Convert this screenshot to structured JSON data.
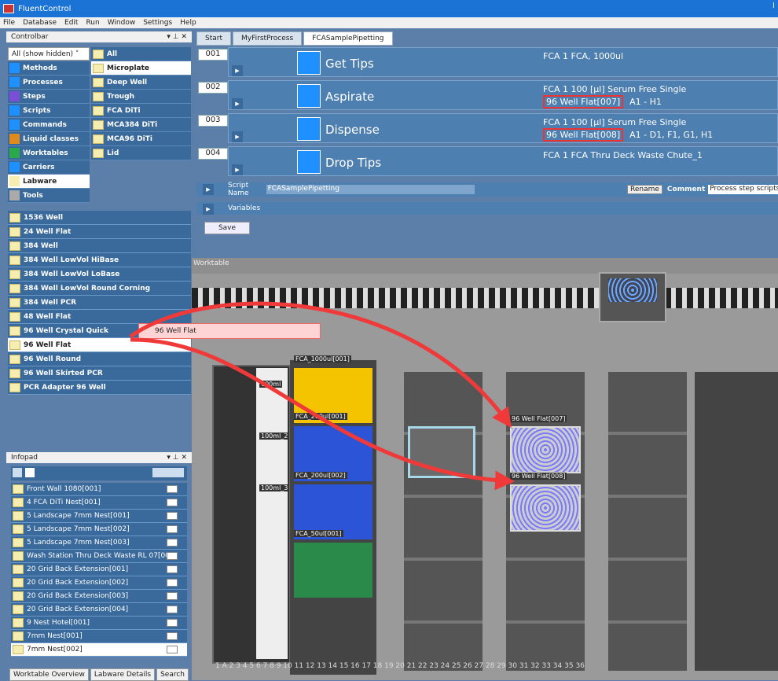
{
  "app": {
    "title": "FluentControl"
  },
  "menu": [
    "File",
    "Database",
    "Edit",
    "Run",
    "Window",
    "Settings",
    "Help"
  ],
  "controlbar": {
    "title": "Controlbar",
    "dropdown": "All (show hidden)",
    "categories": [
      "Methods",
      "Processes",
      "Steps",
      "Scripts",
      "Commands",
      "Liquid classes",
      "Worktables",
      "Carriers",
      "Labware",
      "Tools"
    ],
    "selected_category": "Labware",
    "subcategories": [
      "All",
      "Microplate",
      "Deep Well",
      "Trough",
      "FCA DiTi",
      "MCA384 DiTi",
      "MCA96 DiTi",
      "Lid"
    ],
    "selected_subcategory": "Microplate",
    "labware": [
      "1536 Well",
      "24 Well Flat",
      "384 Well",
      "384 Well LowVol HiBase",
      "384 Well LowVol LoBase",
      "384 Well LowVol Round Corning",
      "384 Well PCR",
      "48 Well Flat",
      "96 Well Crystal Quick",
      "96 Well Flat",
      "96 Well Round",
      "96 Well Skirted PCR",
      "PCR Adapter 96 Well"
    ],
    "selected_labware": "96 Well Flat"
  },
  "infopad": {
    "title": "Infopad",
    "items": [
      "Front Wall 1080[001]",
      "4 FCA DiTi Nest[001]",
      "5 Landscape 7mm Nest[001]",
      "5 Landscape 7mm Nest[002]",
      "5 Landscape 7mm Nest[003]",
      "Wash Station Thru Deck Waste RL 07[001]",
      "20 Grid Back Extension[001]",
      "20 Grid Back Extension[002]",
      "20 Grid Back Extension[003]",
      "20 Grid Back Extension[004]",
      "9 Nest Hotel[001]",
      "7mm Nest[001]",
      "7mm Nest[002]"
    ],
    "selected_item": "7mm Nest[002]"
  },
  "bottom_tabs": [
    "Worktable Overview",
    "Labware Details",
    "Search"
  ],
  "doc_tabs": [
    "Start",
    "MyFirstProcess",
    "FCASamplePipetting"
  ],
  "active_tab": "FCASamplePipetting",
  "steps": [
    {
      "num": "001",
      "title": "Get Tips",
      "line1": "FCA 1   FCA, 1000ul",
      "line2_hl": "",
      "line2": ""
    },
    {
      "num": "002",
      "title": "Aspirate",
      "line1": "FCA 1   100 [µl]   Serum Free Single",
      "line2_hl": "96 Well Flat[007]",
      "line2": "A1 - H1"
    },
    {
      "num": "003",
      "title": "Dispense",
      "line1": "FCA 1   100 [µl]   Serum Free Single",
      "line2_hl": "96 Well Flat[008]",
      "line2": "A1 - D1, F1, G1, H1"
    },
    {
      "num": "004",
      "title": "Drop Tips",
      "line1": "FCA 1   FCA Thru Deck Waste Chute_1",
      "line2_hl": "",
      "line2": ""
    }
  ],
  "script": {
    "label": "Script Name",
    "value": "FCASamplePipetting",
    "rename": "Rename",
    "comment_label": "Comment",
    "comment_value": "Process step scripts"
  },
  "variables_label": "Variables",
  "save_label": "Save",
  "worktable": {
    "label": "Worktable",
    "carriers": [
      "FCA_1000ul[001]",
      "FCA_200ul[001]",
      "FCA_200ul[002]",
      "FCA_50ul[001]",
      "96 Well Flat[007]",
      "96 Well Flat[008]",
      "100ml",
      "100ml_2",
      "100ml_3"
    ],
    "grid_numbers": "1 A 2 3 4 5 6 7 8 9 10 11 12 13 14 15 16 17 18 19 20 21 22 23 24 25 26 27 28 29 30 31 32 33 34 35 36"
  },
  "drag_label": "96 Well Flat",
  "colors": {
    "accent": "#1b73d6",
    "panel": "#3a6a9c",
    "highlight": "#e33333"
  }
}
